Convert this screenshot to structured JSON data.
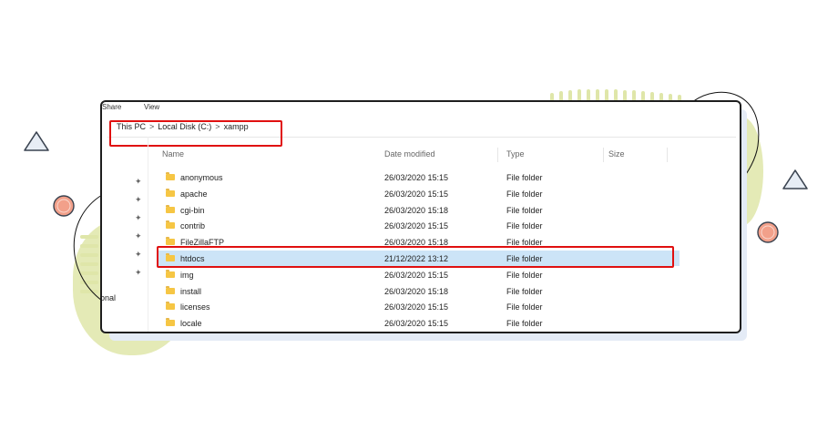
{
  "ribbon": {
    "share": "Share",
    "view": "View"
  },
  "breadcrumb": [
    "This PC",
    "Local Disk (C:)",
    "xampp"
  ],
  "breadcrumb_separator": ">",
  "columns": {
    "name": "Name",
    "date": "Date modified",
    "type": "Type",
    "size": "Size"
  },
  "nav": {
    "partial_label": "onal",
    "pin_symbol": "✦"
  },
  "rows": [
    {
      "name": "anonymous",
      "date": "26/03/2020 15:15",
      "type": "File folder"
    },
    {
      "name": "apache",
      "date": "26/03/2020 15:15",
      "type": "File folder"
    },
    {
      "name": "cgi-bin",
      "date": "26/03/2020 15:18",
      "type": "File folder"
    },
    {
      "name": "contrib",
      "date": "26/03/2020 15:15",
      "type": "File folder"
    },
    {
      "name": "FileZillaFTP",
      "date": "26/03/2020 15:18",
      "type": "File folder"
    },
    {
      "name": "htdocs",
      "date": "21/12/2022 13:12",
      "type": "File folder"
    },
    {
      "name": "img",
      "date": "26/03/2020 15:15",
      "type": "File folder"
    },
    {
      "name": "install",
      "date": "26/03/2020 15:18",
      "type": "File folder"
    },
    {
      "name": "licenses",
      "date": "26/03/2020 15:15",
      "type": "File folder"
    },
    {
      "name": "locale",
      "date": "26/03/2020 15:15",
      "type": "File folder"
    }
  ],
  "colors": {
    "highlight": "#e01010",
    "selection": "#cce4f7",
    "folder": "#f6c644",
    "decor_green": "#dfe6a9",
    "decor_coral": "#f2a08a"
  }
}
